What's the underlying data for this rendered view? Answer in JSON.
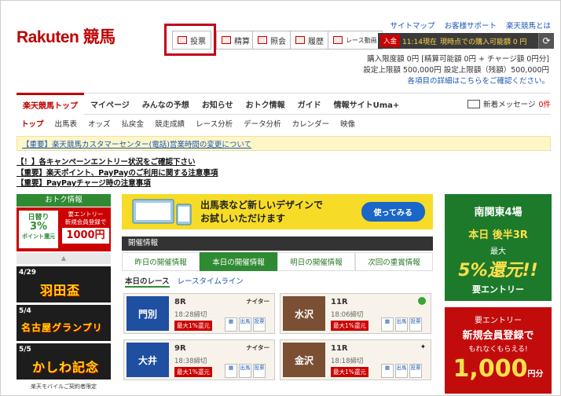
{
  "header": {
    "logo": "Rakuten 競馬",
    "top_links": [
      "サイトマップ",
      "お客様サポート",
      "楽天競馬とは"
    ],
    "buttons": [
      "投票",
      "精算",
      "照会",
      "履歴",
      "レース動画"
    ],
    "info_bar": {
      "badge": "入金",
      "time": "11:14現在",
      "text": "現時点での購入可能額 0 円"
    },
    "info_lines": [
      "購入限度額 0円 [精算可能額 0円 + チャージ額 0円分]",
      "設定上限額 500,000円 設定上限額（残額）500,000円",
      "各項目の詳細はこちらをご確認ください。"
    ]
  },
  "nav": {
    "main": [
      "楽天競馬トップ",
      "マイページ",
      "みんなの予想",
      "お知らせ",
      "おトク情報",
      "ガイド",
      "情報サイトUma+"
    ],
    "message": "新着メッセージ",
    "message_count": "0件",
    "sub": [
      "トップ",
      "出馬表",
      "オッズ",
      "払戻金",
      "競走成績",
      "レース分析",
      "データ分析",
      "カレンダー",
      "映像"
    ]
  },
  "notice": "【重要】楽天競馬カスタマーセンター(電話)営業時間の変更について",
  "news": [
    "【！】各キャンペーンエントリー状況をご確認下さい",
    "【重要】楽天ポイント、PayPayのご利用に関する注意事項",
    "【重要】PayPayチャージ時の注意事項"
  ],
  "left": {
    "otoku_title": "おトク情報",
    "otoku_banner": {
      "a": "日替り",
      "b": "3%",
      "c": "ポイント還元",
      "d": "要エントリー",
      "e": "新規会員登録で",
      "f": "1000円"
    },
    "races": [
      {
        "date": "4/29",
        "name": "羽田盃"
      },
      {
        "date": "5/4",
        "name": "名古屋グランプリ"
      },
      {
        "date": "5/5",
        "name": "かしわ記念"
      }
    ],
    "footer": "楽天モバイルご契約者限定"
  },
  "promo": {
    "line1": "出馬表など新しいデザインで",
    "line2": "お試しいただけます",
    "button": "使ってみる"
  },
  "kaisai": {
    "title": "開催情報",
    "tabs": [
      "昨日の開催情報",
      "本日の開催情報",
      "明日の開催情報",
      "次回の重賞情報"
    ],
    "subtabs": [
      "本日のレース",
      "レースタイムライン"
    ],
    "cards": [
      {
        "venue": "門別",
        "race": "8R",
        "time": "18:28締切",
        "badge": "最大1%還元",
        "label": "ナイター"
      },
      {
        "venue": "水沢",
        "race": "11R",
        "time": "18:06締切",
        "badge": "最大1%還元",
        "label": ""
      },
      {
        "venue": "大井",
        "race": "9R",
        "time": "18:38締切",
        "badge": "最大1%還元",
        "label": "ナイター"
      },
      {
        "venue": "金沢",
        "race": "11R",
        "time": "18:18締切",
        "badge": "最大1%還元",
        "label": ""
      }
    ],
    "card_links": [
      "出馬",
      "投票"
    ]
  },
  "right": {
    "banner1": {
      "a": "南関東4場",
      "b": "本日 後半3R",
      "c": "最大",
      "d": "5%還元!!",
      "e": "要エントリー"
    },
    "banner2": {
      "a": "要エントリー",
      "b": "新規会員登録で",
      "c": "もれなくもらえる!",
      "d": "1,000",
      "e": "円分"
    }
  }
}
